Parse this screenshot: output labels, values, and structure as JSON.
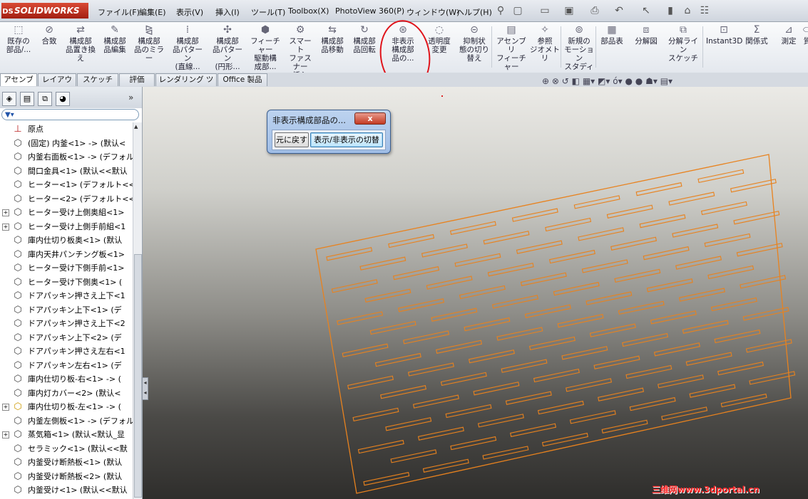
{
  "app": {
    "logo_text": "SOLIDWORKS",
    "logo_badge": "DS"
  },
  "menu": [
    "ファイル(F)",
    "編集(E)",
    "表示(V)",
    "挿入(I)",
    "ツール(T)",
    "Toolbox(X)",
    "PhotoView 360(P)",
    "ウィンドウ(W)",
    "ヘルプ(H)"
  ],
  "ribbon": [
    {
      "label": "既存の\n部品/...",
      "icon": "insert-component-icon"
    },
    {
      "label": "合致",
      "icon": "mate-icon"
    },
    {
      "label": "構成部\n品置き換\nえ",
      "icon": "replace-component-icon"
    },
    {
      "label": "構成部\n品編集",
      "icon": "edit-component-icon"
    },
    {
      "label": "構成部\n品のミラー",
      "icon": "mirror-component-icon"
    },
    {
      "label": "構成部\n品パターン\n(直線...",
      "icon": "linear-pattern-icon"
    },
    {
      "label": "構成部\n品パターン\n(円形...",
      "icon": "circular-pattern-icon"
    },
    {
      "label": "フィーチャー\n駆動構\n成部...",
      "icon": "feature-driven-icon"
    },
    {
      "label": "スマート\nファスナー\n挿入",
      "icon": "smart-fastener-icon"
    },
    {
      "label": "構成部\n品移動",
      "icon": "move-component-icon"
    },
    {
      "label": "構成部\n品回転",
      "icon": "rotate-component-icon"
    },
    {
      "label": "非表示\n構成部\n品の...",
      "icon": "show-hidden-components-icon"
    },
    {
      "label": "透明度\n変更",
      "icon": "transparency-icon"
    },
    {
      "label": "抑制状\n態の切り\n替え",
      "icon": "suppress-toggle-icon"
    },
    {
      "label": "アセンブリ\nフィーチャー",
      "icon": "assembly-feature-icon"
    },
    {
      "label": "参照\nジオメトリ",
      "icon": "reference-geometry-icon"
    },
    {
      "label": "新規の\nモーション\nスタディ",
      "icon": "motion-study-icon"
    },
    {
      "label": "部品表",
      "icon": "bom-icon"
    },
    {
      "label": "分解図",
      "icon": "exploded-view-icon"
    },
    {
      "label": "分解ライン\nスケッチ",
      "icon": "explode-line-icon"
    },
    {
      "label": "Instant3D",
      "icon": "instant3d-icon"
    },
    {
      "label": "関係式",
      "icon": "equations-icon"
    },
    {
      "label": "測定",
      "icon": "measure-icon"
    },
    {
      "label": "質",
      "icon": "mass-icon"
    }
  ],
  "tabs": [
    "アセンブリ",
    "レイアウト",
    "スケッチ",
    "評価",
    "レンダリング ツール",
    "Office 製品"
  ],
  "tree": [
    {
      "label": "原点",
      "expandable": false
    },
    {
      "label": "(固定) 内釜<1> -> (默认<",
      "expandable": false
    },
    {
      "label": "内釜右面板<1> -> (デフォル",
      "expandable": false
    },
    {
      "label": "間口金具<1> (默认<<默认",
      "expandable": false
    },
    {
      "label": "ヒーター<1> (デフォルト<<デ",
      "expandable": false
    },
    {
      "label": "ヒーター<2> (デフォルト<<デ",
      "expandable": false
    },
    {
      "label": "ヒーター受け上側奥組<1>",
      "expandable": true
    },
    {
      "label": "ヒーター受け上側手前組<1",
      "expandable": true
    },
    {
      "label": "庫内仕切り板奥<1> (默认",
      "expandable": false
    },
    {
      "label": "庫内天井パンチング板<1>",
      "expandable": false
    },
    {
      "label": "ヒーター受け下側手前<1>",
      "expandable": false
    },
    {
      "label": "ヒーター受け下側奥<1> (",
      "expandable": false
    },
    {
      "label": "ドアパッキン押さえ上下<1",
      "expandable": false
    },
    {
      "label": "ドアパッキン上下<1> (デ",
      "expandable": false
    },
    {
      "label": "ドアパッキン押さえ上下<2",
      "expandable": false
    },
    {
      "label": "ドアパッキン上下<2> (デ",
      "expandable": false
    },
    {
      "label": "ドアパッキン押さえ左右<1",
      "expandable": false
    },
    {
      "label": "ドアパッキン左右<1> (デ",
      "expandable": false
    },
    {
      "label": "庫内仕切り板-右<1> -> (",
      "expandable": false
    },
    {
      "label": "庫内灯カバー<2> (默认<",
      "expandable": false
    },
    {
      "label": "庫内仕切り板-左<1> -> (",
      "expandable": true
    },
    {
      "label": "内釜左側板<1> -> (デフォル",
      "expandable": false
    },
    {
      "label": "蒸気箱<1> (默认<默认_显",
      "expandable": true
    },
    {
      "label": "セラミック<1> (默认<<默",
      "expandable": false
    },
    {
      "label": "内釜受け断熱板<1> (默认",
      "expandable": false
    },
    {
      "label": "内釜受け断熱板<2> (默认",
      "expandable": false
    },
    {
      "label": "内釜受け<1> (默认<<默认",
      "expandable": false
    }
  ],
  "dialog": {
    "title": "非表示構成部品の...",
    "close": "x",
    "undo": "元に戻す",
    "toggle": "表示/非表示の切替"
  },
  "plate": {
    "color": "#e8821e",
    "rows": 15,
    "slots_per_row": 7
  },
  "watermark": "三维网www.3dportal.cn",
  "colors": {
    "annotation": "#e0141b",
    "accent": "#e8821e"
  }
}
